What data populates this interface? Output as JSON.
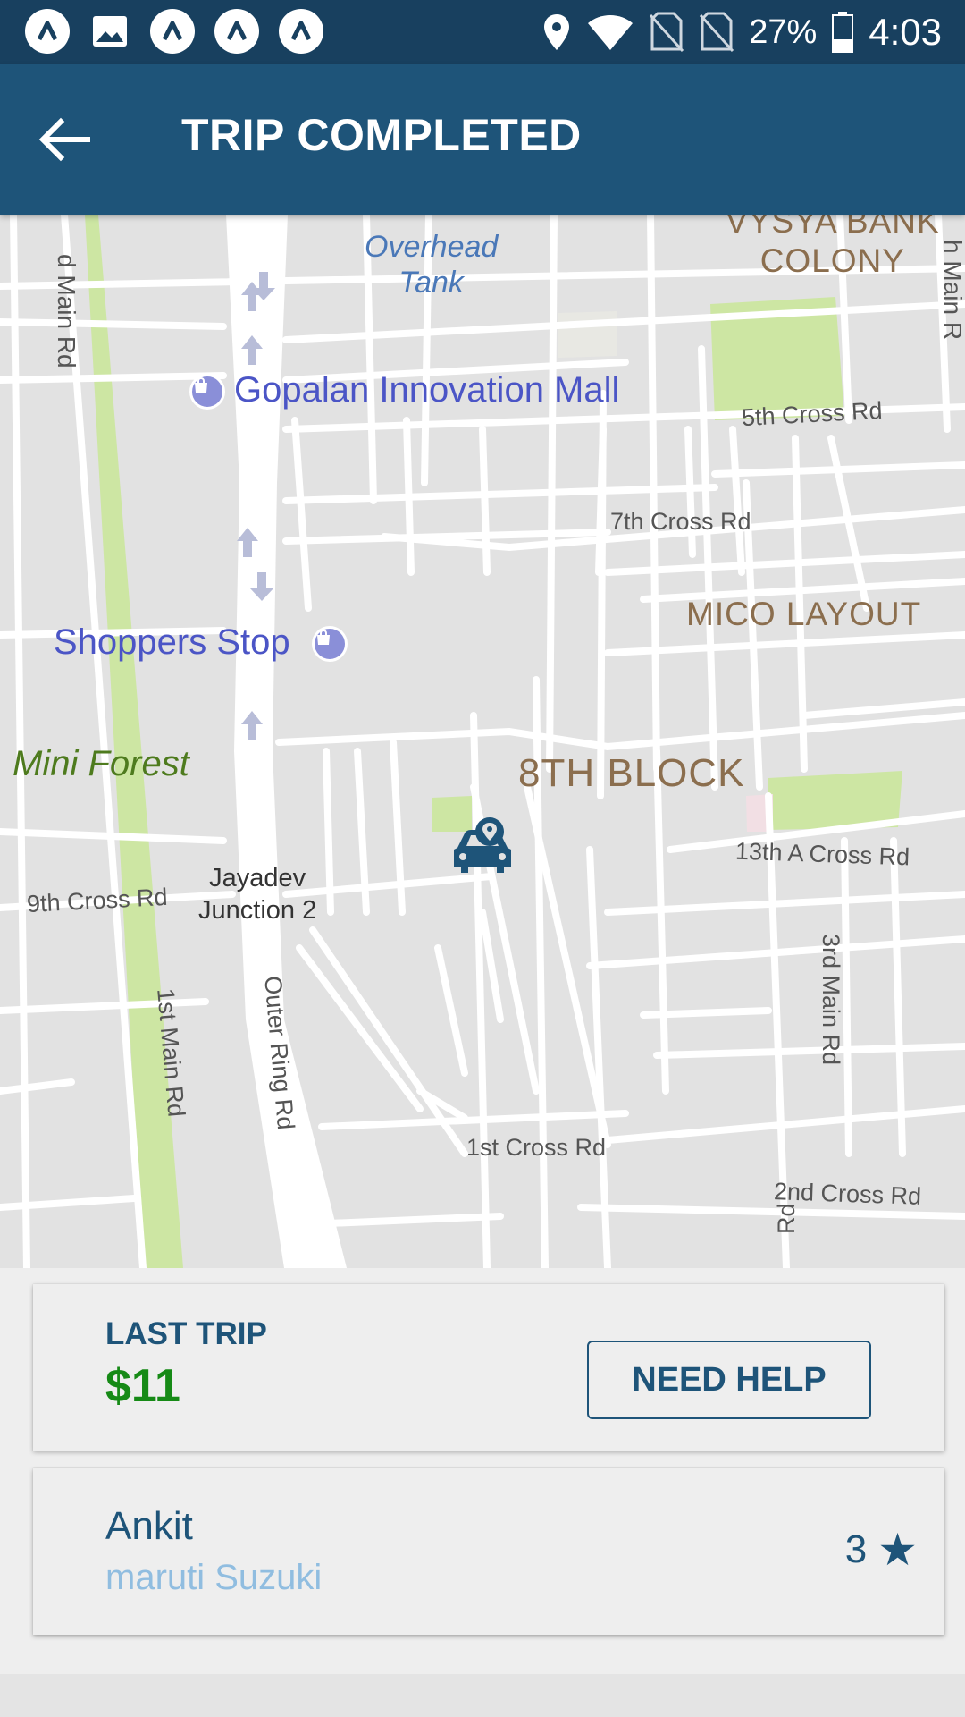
{
  "status_bar": {
    "battery": "27%",
    "time": "4:03"
  },
  "app_bar": {
    "title": "TRIP COMPLETED"
  },
  "map": {
    "labels": {
      "vysya_bank": "VYSYA BANK\nCOLONY",
      "overhead_tank": "Overhead\nTank",
      "main_rd_left": "d Main Rd",
      "main_rd_right": "h Main R",
      "gopalan_mall": "Gopalan Innovation Mall",
      "fifth_cross": "5th Cross Rd",
      "seventh_cross": "7th Cross Rd",
      "mico_layout": "MICO LAYOUT",
      "shoppers_stop": "Shoppers Stop",
      "mini_forest": "Mini Forest",
      "eighth_block": "8TH BLOCK",
      "thirteenth_a_cross": "13th A Cross Rd",
      "ninth_cross": "9th Cross Rd",
      "jayadev": "Jayadev\nJunction 2",
      "third_main": "3rd Main Rd",
      "first_main": "1st Main Rd",
      "outer_ring": "Outer Ring Rd",
      "first_cross": "1st Cross Rd",
      "second_cross": "2nd Cross Rd",
      "rd_bottom": "Rd"
    },
    "marker_icon": "car-pin-icon"
  },
  "last_trip": {
    "label": "LAST TRIP",
    "fare": "$11",
    "help_button": "NEED HELP"
  },
  "driver": {
    "name": "Ankit",
    "car": "maruti Suzuki",
    "rating": "3",
    "rating_icon": "star-icon"
  },
  "colors": {
    "status_bar": "#18405f",
    "app_bar": "#1e5479",
    "fare_green": "#168a16",
    "car_model": "#90bde0"
  }
}
